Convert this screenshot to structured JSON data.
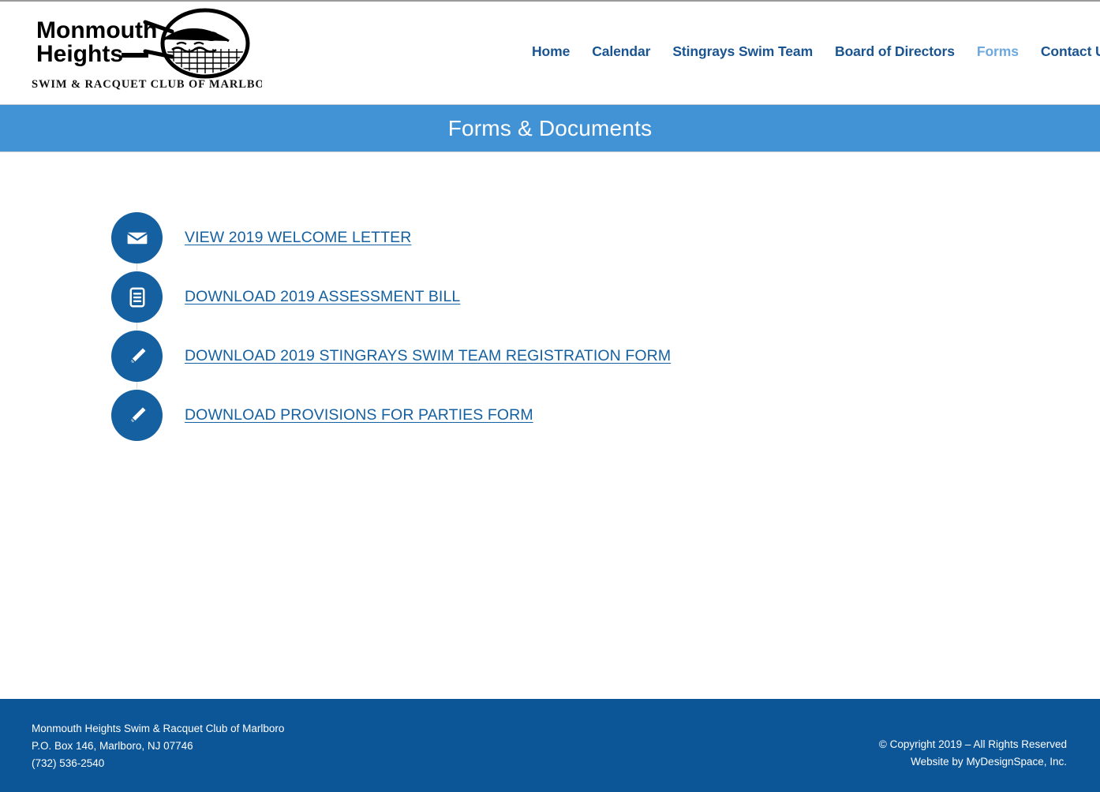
{
  "colors": {
    "nav_link": "#1a5490",
    "nav_active": "#6ea8dd",
    "banner_bg": "#4292d6",
    "icon_bubble": "#1560a0",
    "content_link": "#1560a0",
    "footer_bg": "#0c5596",
    "page_bg": "#ffffff"
  },
  "header": {
    "logo": {
      "line1": "Monmouth",
      "line2": "Heights",
      "tagline": "SWIM & RACQUET CLUB OF MARLBORO",
      "icon_name": "tennis-racquet-swimmer-logo"
    },
    "nav": [
      {
        "label": "Home",
        "active": false
      },
      {
        "label": "Calendar",
        "active": false
      },
      {
        "label": "Stingrays Swim Team",
        "active": false
      },
      {
        "label": "Board of Directors",
        "active": false
      },
      {
        "label": "Forms",
        "active": true
      },
      {
        "label": "Contact Us",
        "active": false
      }
    ]
  },
  "banner": {
    "title": "Forms & Documents"
  },
  "documents": [
    {
      "label": "VIEW 2019 WELCOME LETTER",
      "icon": "envelope-icon"
    },
    {
      "label": "DOWNLOAD 2019 ASSESSMENT BILL",
      "icon": "document-icon"
    },
    {
      "label": "DOWNLOAD 2019 STINGRAYS SWIM TEAM REGISTRATION FORM",
      "icon": "pencil-icon"
    },
    {
      "label": "DOWNLOAD PROVISIONS FOR PARTIES FORM",
      "icon": "pencil-icon"
    }
  ],
  "footer": {
    "address": {
      "line1": "Monmouth Heights Swim & Racquet Club of Marlboro",
      "line2": "P.O. Box 146, Marlboro, NJ 07746",
      "line3": "(732) 536-2540"
    },
    "legal": {
      "line1": "© Copyright 2019 – All Rights Reserved",
      "line2": "Website by MyDesignSpace, Inc."
    }
  }
}
